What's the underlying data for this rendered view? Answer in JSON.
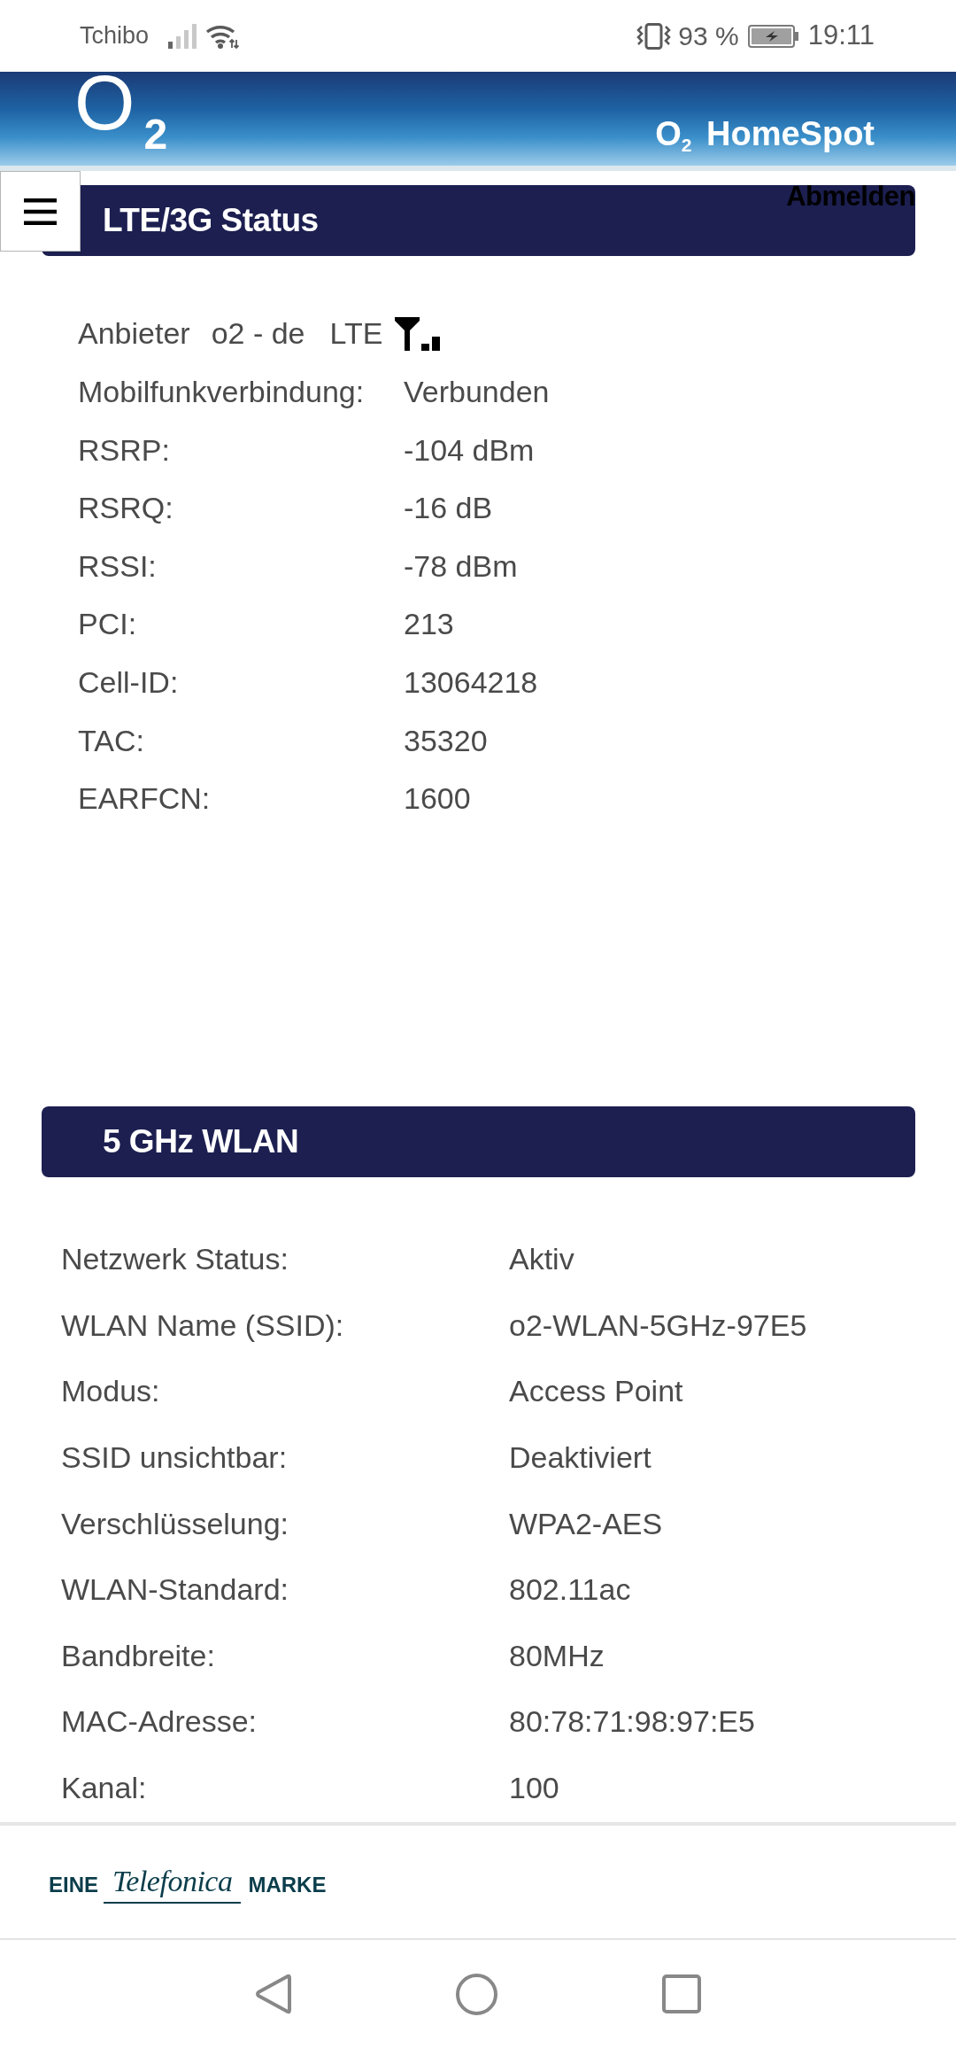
{
  "status_bar": {
    "carrier": "Tchibo",
    "battery": "93 %",
    "time": "19:11"
  },
  "header": {
    "logo": "O$_{2}$",
    "title": "O$_{2}$ HomeSpot"
  },
  "logout": "Abmelden",
  "sections": [
    {
      "kind": "lte",
      "title": "LTE/3G Status",
      "provider": {
        "label": "Anbieter",
        "name": "o2 - de",
        "network": "LTE"
      },
      "rows": [
        {
          "label": "Mobilfunkverbindung:",
          "value": "Verbunden"
        },
        {
          "label": "RSRP:",
          "value": "-104 dBm"
        },
        {
          "label": "RSRQ:",
          "value": "-16 dB"
        },
        {
          "label": "RSSI:",
          "value": "-78 dBm"
        },
        {
          "label": "PCI:",
          "value": "213"
        },
        {
          "label": "Cell-ID:",
          "value": "13064218"
        },
        {
          "label": "TAC:",
          "value": "35320"
        },
        {
          "label": "EARFCN:",
          "value": "1600"
        }
      ]
    },
    {
      "kind": "wlan",
      "title": "5 GHz WLAN",
      "rows": [
        {
          "label": "Netzwerk Status:",
          "value": "Aktiv"
        },
        {
          "label": "WLAN Name (SSID):",
          "value": "o2-WLAN-5GHz-97E5"
        },
        {
          "label": "Modus:",
          "value": "Access Point"
        },
        {
          "label": "SSID unsichtbar:",
          "value": "Deaktiviert"
        },
        {
          "label": "Verschlüsselung:",
          "value": "WPA2-AES"
        },
        {
          "label": "WLAN-Standard:",
          "value": "802.11ac"
        },
        {
          "label": "Bandbreite:",
          "value": "80MHz"
        },
        {
          "label": "MAC-Adresse:",
          "value": "80:78:71:98:97:E5"
        },
        {
          "label": "Kanal:",
          "value": "100"
        }
      ]
    }
  ],
  "footer": {
    "prefix": "EINE",
    "brand": "Telefonica",
    "suffix": "MARKE"
  }
}
